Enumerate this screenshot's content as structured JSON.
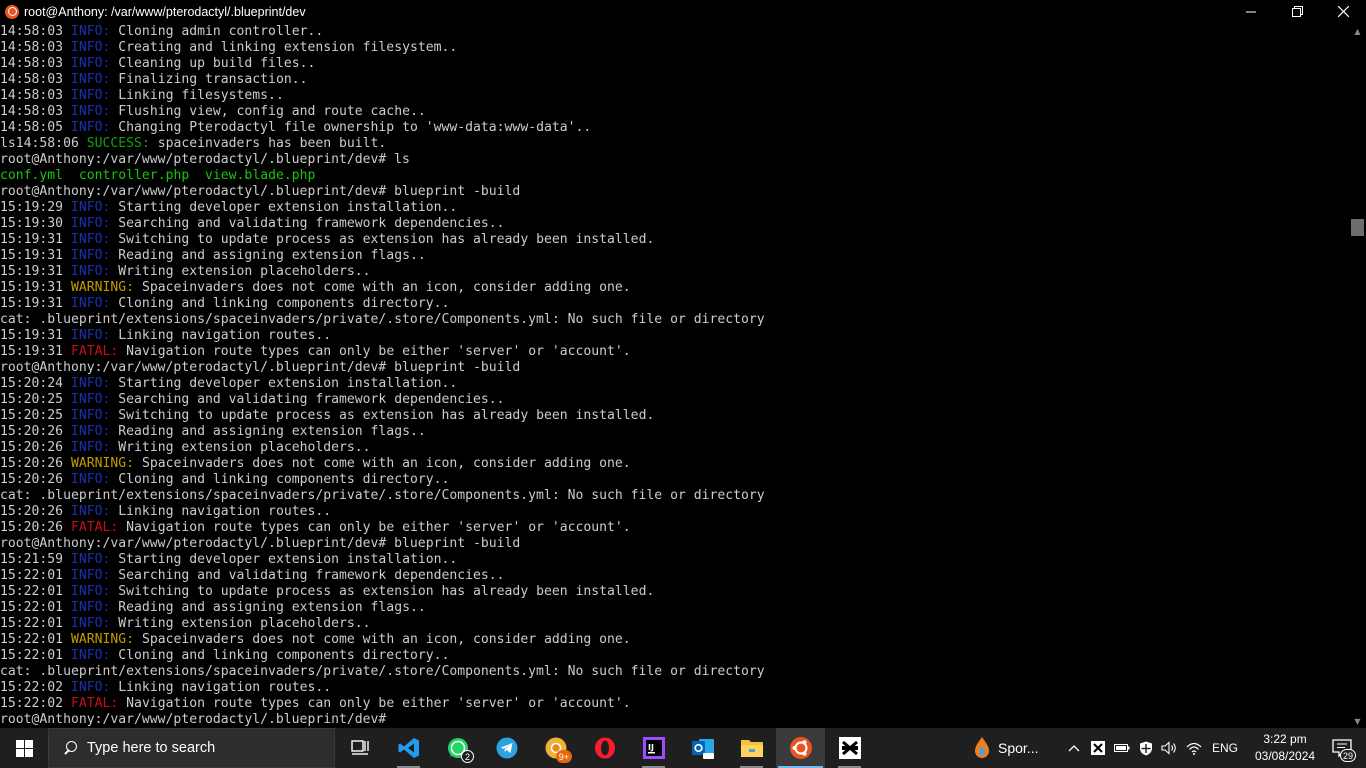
{
  "window": {
    "title": "root@Anthony: /var/www/pterodactyl/.blueprint/dev",
    "icon": "ubuntu-icon",
    "controls": [
      "minimize-icon",
      "restore-icon",
      "close-icon"
    ]
  },
  "terminal": {
    "colors": {
      "info": "#1a2fb0",
      "success": "#13a10e",
      "warning": "#c19c00",
      "fatal": "#c50f1f",
      "text": "#cccccc",
      "file": "#16c60c"
    },
    "lines": [
      {
        "time": "14:58:03",
        "level": "INFO:",
        "type": "info",
        "msg": "Cloning admin controller.."
      },
      {
        "time": "14:58:03",
        "level": "INFO:",
        "type": "info",
        "msg": "Creating and linking extension filesystem.."
      },
      {
        "time": "14:58:03",
        "level": "INFO:",
        "type": "info",
        "msg": "Cleaning up build files.."
      },
      {
        "time": "14:58:03",
        "level": "INFO:",
        "type": "info",
        "msg": "Finalizing transaction.."
      },
      {
        "time": "14:58:03",
        "level": "INFO:",
        "type": "info",
        "msg": "Linking filesystems.."
      },
      {
        "time": "14:58:03",
        "level": "INFO:",
        "type": "info",
        "msg": "Flushing view, config and route cache.."
      },
      {
        "time": "14:58:05",
        "level": "INFO:",
        "type": "info",
        "msg": "Changing Pterodactyl file ownership to 'www-data:www-data'.."
      },
      {
        "time": "ls14:58:06",
        "level": "SUCCESS:",
        "type": "success",
        "msg": "spaceinvaders has been built."
      },
      {
        "type": "prompt",
        "text": "root@Anthony:/var/www/pterodactyl/.blueprint/dev# ls"
      },
      {
        "type": "files",
        "files": [
          "conf.yml",
          "controller.php",
          "view.blade.php"
        ]
      },
      {
        "type": "prompt",
        "text": "root@Anthony:/var/www/pterodactyl/.blueprint/dev# blueprint -build"
      },
      {
        "time": "15:19:29",
        "level": "INFO:",
        "type": "info",
        "msg": "Starting developer extension installation.."
      },
      {
        "time": "15:19:30",
        "level": "INFO:",
        "type": "info",
        "msg": "Searching and validating framework dependencies.."
      },
      {
        "time": "15:19:31",
        "level": "INFO:",
        "type": "info",
        "msg": "Switching to update process as extension has already been installed."
      },
      {
        "time": "15:19:31",
        "level": "INFO:",
        "type": "info",
        "msg": "Reading and assigning extension flags.."
      },
      {
        "time": "15:19:31",
        "level": "INFO:",
        "type": "info",
        "msg": "Writing extension placeholders.."
      },
      {
        "time": "15:19:31",
        "level": "WARNING:",
        "type": "warning",
        "msg": "Spaceinvaders does not come with an icon, consider adding one."
      },
      {
        "time": "15:19:31",
        "level": "INFO:",
        "type": "info",
        "msg": "Cloning and linking components directory.."
      },
      {
        "type": "plain",
        "text": "cat: .blueprint/extensions/spaceinvaders/private/.store/Components.yml: No such file or directory"
      },
      {
        "time": "15:19:31",
        "level": "INFO:",
        "type": "info",
        "msg": "Linking navigation routes.."
      },
      {
        "time": "15:19:31",
        "level": "FATAL:",
        "type": "fatal",
        "msg": "Navigation route types can only be either 'server' or 'account'."
      },
      {
        "type": "prompt",
        "text": "root@Anthony:/var/www/pterodactyl/.blueprint/dev# blueprint -build"
      },
      {
        "time": "15:20:24",
        "level": "INFO:",
        "type": "info",
        "msg": "Starting developer extension installation.."
      },
      {
        "time": "15:20:25",
        "level": "INFO:",
        "type": "info",
        "msg": "Searching and validating framework dependencies.."
      },
      {
        "time": "15:20:25",
        "level": "INFO:",
        "type": "info",
        "msg": "Switching to update process as extension has already been installed."
      },
      {
        "time": "15:20:26",
        "level": "INFO:",
        "type": "info",
        "msg": "Reading and assigning extension flags.."
      },
      {
        "time": "15:20:26",
        "level": "INFO:",
        "type": "info",
        "msg": "Writing extension placeholders.."
      },
      {
        "time": "15:20:26",
        "level": "WARNING:",
        "type": "warning",
        "msg": "Spaceinvaders does not come with an icon, consider adding one."
      },
      {
        "time": "15:20:26",
        "level": "INFO:",
        "type": "info",
        "msg": "Cloning and linking components directory.."
      },
      {
        "type": "plain",
        "text": "cat: .blueprint/extensions/spaceinvaders/private/.store/Components.yml: No such file or directory"
      },
      {
        "time": "15:20:26",
        "level": "INFO:",
        "type": "info",
        "msg": "Linking navigation routes.."
      },
      {
        "time": "15:20:26",
        "level": "FATAL:",
        "type": "fatal",
        "msg": "Navigation route types can only be either 'server' or 'account'."
      },
      {
        "type": "prompt",
        "text": "root@Anthony:/var/www/pterodactyl/.blueprint/dev# blueprint -build"
      },
      {
        "time": "15:21:59",
        "level": "INFO:",
        "type": "info",
        "msg": "Starting developer extension installation.."
      },
      {
        "time": "15:22:01",
        "level": "INFO:",
        "type": "info",
        "msg": "Searching and validating framework dependencies.."
      },
      {
        "time": "15:22:01",
        "level": "INFO:",
        "type": "info",
        "msg": "Switching to update process as extension has already been installed."
      },
      {
        "time": "15:22:01",
        "level": "INFO:",
        "type": "info",
        "msg": "Reading and assigning extension flags.."
      },
      {
        "time": "15:22:01",
        "level": "INFO:",
        "type": "info",
        "msg": "Writing extension placeholders.."
      },
      {
        "time": "15:22:01",
        "level": "WARNING:",
        "type": "warning",
        "msg": "Spaceinvaders does not come with an icon, consider adding one."
      },
      {
        "time": "15:22:01",
        "level": "INFO:",
        "type": "info",
        "msg": "Cloning and linking components directory.."
      },
      {
        "type": "plain",
        "text": "cat: .blueprint/extensions/spaceinvaders/private/.store/Components.yml: No such file or directory"
      },
      {
        "time": "15:22:02",
        "level": "INFO:",
        "type": "info",
        "msg": "Linking navigation routes.."
      },
      {
        "time": "15:22:02",
        "level": "FATAL:",
        "type": "fatal",
        "msg": "Navigation route types can only be either 'server' or 'account'."
      },
      {
        "type": "prompt",
        "text": "root@Anthony:/var/www/pterodactyl/.blueprint/dev#"
      }
    ]
  },
  "taskbar": {
    "search_placeholder": "Type here to search",
    "apps": [
      {
        "name": "task-view-icon",
        "running": false
      },
      {
        "name": "vscode-icon",
        "running": true
      },
      {
        "name": "whatsapp-icon",
        "running": false,
        "badge": "2"
      },
      {
        "name": "telegram-icon",
        "running": false
      },
      {
        "name": "chrome-canary-icon",
        "running": false,
        "badge": "9+"
      },
      {
        "name": "opera-icon",
        "running": false
      },
      {
        "name": "jetbrains-icon",
        "running": true
      },
      {
        "name": "outlook-icon",
        "running": false
      },
      {
        "name": "file-explorer-icon",
        "running": true
      },
      {
        "name": "ubuntu-icon",
        "running": true,
        "active": true
      },
      {
        "name": "capcut-icon",
        "running": true
      }
    ],
    "weather_text": "Spor...",
    "language": "ENG",
    "time": "3:22 pm",
    "date": "03/08/2024",
    "notification_count": "29"
  }
}
